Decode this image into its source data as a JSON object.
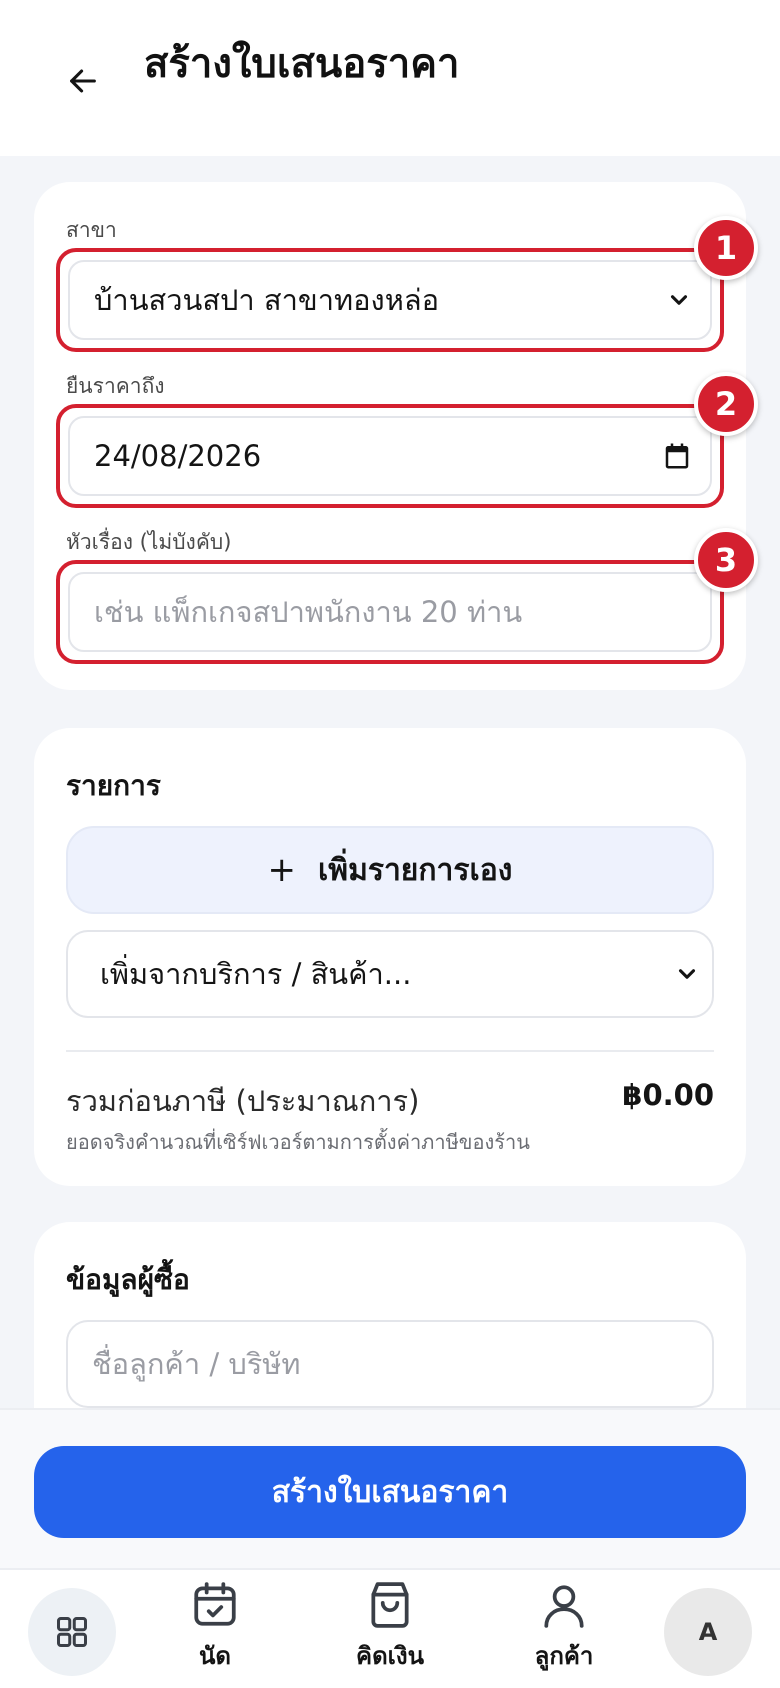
{
  "header": {
    "title": "สร้างใบเสนอราคา",
    "back_icon": "arrow-left-icon"
  },
  "form": {
    "branch_label": "สาขา",
    "branch_value": "บ้านสวนสปา สาขาทองหล่อ",
    "valid_until_label": "ยืนราคาถึง",
    "valid_until_value": "24/08/2026",
    "subject_label": "หัวเรื่อง (ไม่บังคับ)",
    "subject_placeholder": "เช่น แพ็กเกจสปาพนักงาน 20 ท่าน",
    "badges": [
      "1",
      "2",
      "3"
    ],
    "highlight_color": "#d4202f"
  },
  "items": {
    "title": "รายการ",
    "add_manual_plus": "+",
    "add_manual_label": "เพิ่มรายการเอง",
    "add_from_catalog": "เพิ่มจากบริการ / สินค้า...",
    "subtotal_label": "รวมก่อนภาษี (ประมาณการ)",
    "subtotal_value": "฿0.00",
    "subtotal_note": "ยอดจริงคำนวณที่เซิร์ฟเวอร์ตามการตั้งค่าภาษีของร้าน"
  },
  "buyer": {
    "title": "ข้อมูลผู้ซื้อ",
    "name_placeholder": "ชื่อลูกค้า / บริษัท"
  },
  "submit": {
    "label": "สร้างใบเสนอราคา",
    "color": "#2563eb"
  },
  "nav": {
    "home_icon": "grid-icon",
    "appointments": "นัด",
    "checkout": "คิดเงิน",
    "customers": "ลูกค้า",
    "avatar_initial": "A"
  }
}
